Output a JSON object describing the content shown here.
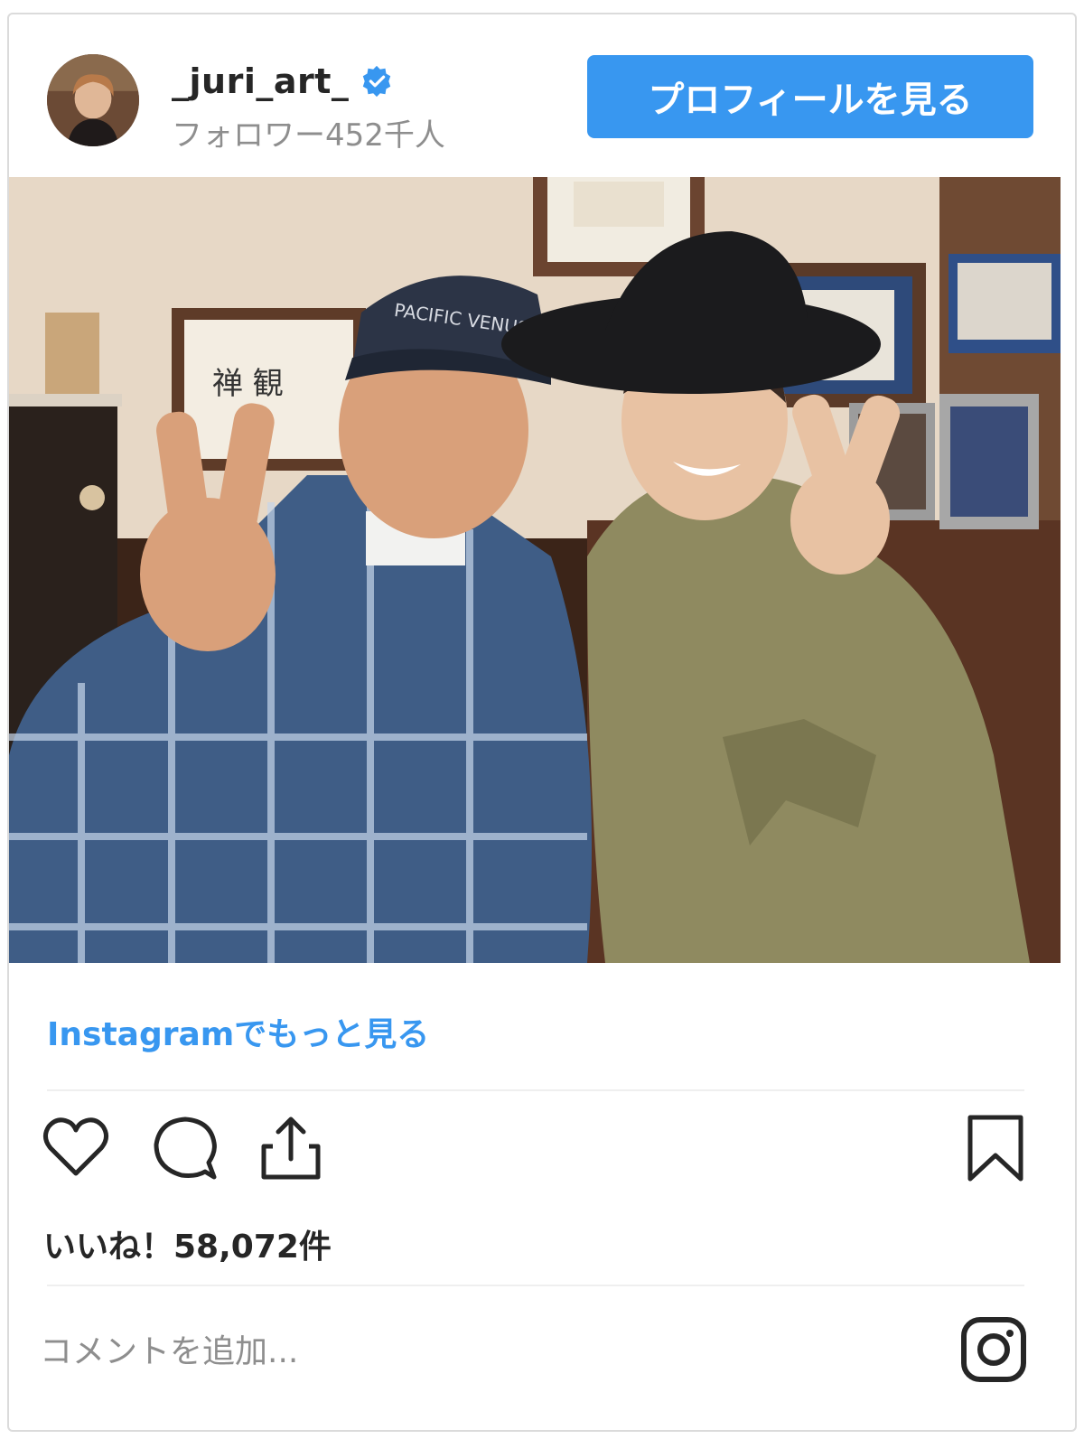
{
  "header": {
    "username": "_juri_art_",
    "followers": "フォロワー452千人",
    "profile_button": "プロフィールを見る",
    "verified_icon": "verified-badge-icon"
  },
  "post": {
    "more_link": "Instagramでもっと見る",
    "likes": "いいね！58,072件"
  },
  "comment": {
    "placeholder": "コメントを追加..."
  },
  "icons": [
    "heart-icon",
    "comment-icon",
    "share-icon",
    "bookmark-icon",
    "instagram-logo-icon"
  ],
  "colors": {
    "accent": "#3897f0",
    "text": "#262626",
    "muted": "#8e8e8e",
    "border": "#dbdbdb"
  }
}
